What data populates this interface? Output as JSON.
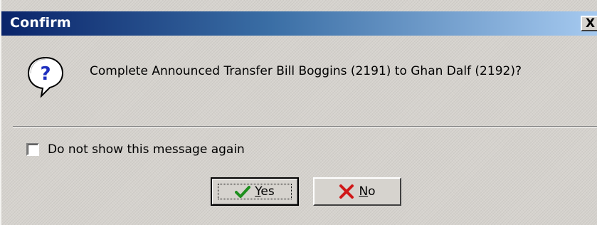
{
  "dialog": {
    "title": "Confirm",
    "close_label": "X",
    "message": "Complete Announced Transfer Bill Boggins (2191) to Ghan Dalf (2192)?",
    "icon": "question-icon"
  },
  "checkbox": {
    "label": "Do not show this message again",
    "checked": false
  },
  "buttons": {
    "yes": {
      "accel": "Y",
      "rest": "es",
      "icon": "check-icon"
    },
    "no": {
      "accel": "N",
      "rest": "o",
      "icon": "x-icon"
    }
  },
  "colors": {
    "titlebar_start": "#0a246a",
    "titlebar_end": "#a6caf0",
    "face": "#d6d3ce"
  }
}
